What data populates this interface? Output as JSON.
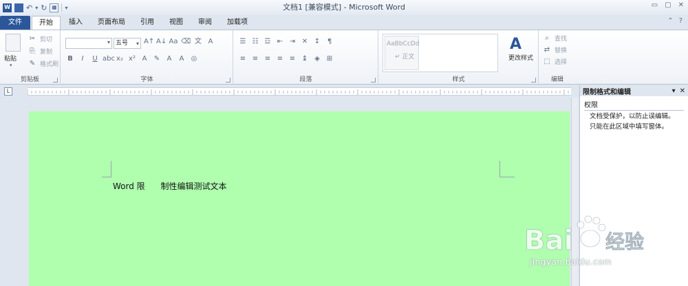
{
  "window": {
    "title": "文档1 [兼容模式] - Microsoft Word",
    "app_icon_letter": "W"
  },
  "tabs": [
    {
      "label": "文件"
    },
    {
      "label": "开始"
    },
    {
      "label": "插入"
    },
    {
      "label": "页面布局"
    },
    {
      "label": "引用"
    },
    {
      "label": "视图"
    },
    {
      "label": "审阅"
    },
    {
      "label": "加载项"
    }
  ],
  "ribbon": {
    "clipboard": {
      "label": "剪贴板",
      "paste": "粘贴",
      "cut": "剪切",
      "copy": "复制",
      "format_painter": "格式刷"
    },
    "font": {
      "label": "字体",
      "size_value": "五号"
    },
    "paragraph": {
      "label": "段落"
    },
    "styles": {
      "label": "样式",
      "sample": "AaBbCcDd",
      "normal": "↵ 正文",
      "change_styles": "更改样式"
    },
    "editing": {
      "label": "编辑",
      "find": "查找",
      "replace": "替换",
      "select": "选择"
    }
  },
  "document": {
    "text": "Word 限      制性编辑测试文本",
    "background_color": "#afffaf"
  },
  "pane": {
    "title": "限制格式和编辑",
    "section": "权限",
    "line1": "文档受保护，以防止误编辑。",
    "line2": "只能在此区域中填写窗体。"
  },
  "watermark": {
    "brand": "Bai",
    "brand_suffix": "经验",
    "url": "jingyan.baidu.com"
  },
  "colors": {
    "file_tab": "#2b579a",
    "page_green": "#afffaf"
  }
}
